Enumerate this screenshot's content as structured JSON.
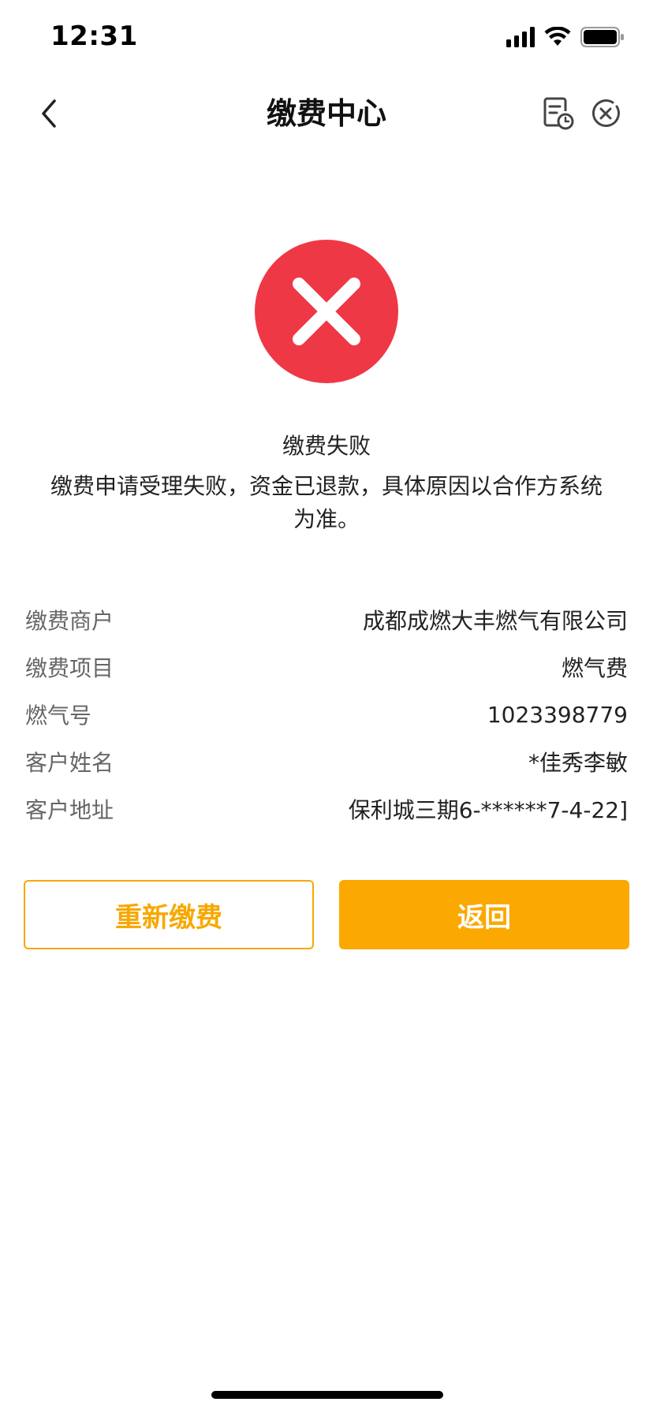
{
  "status_bar": {
    "time": "12:31"
  },
  "nav": {
    "title": "缴费中心",
    "back_icon": "chevron-left-icon",
    "history_icon": "bill-history-icon",
    "close_icon": "close-circle-icon"
  },
  "result": {
    "icon": "error-cross-icon",
    "title": "缴费失败",
    "description": "缴费申请受理失败，资金已退款，具体原因以合作方系统为准。"
  },
  "info": [
    {
      "label": "缴费商户",
      "value": "成都成燃大丰燃气有限公司"
    },
    {
      "label": "缴费项目",
      "value": "燃气费"
    },
    {
      "label": "燃气号",
      "value": "1023398779"
    },
    {
      "label": "客户姓名",
      "value": "*佳秀李敏"
    },
    {
      "label": "客户地址",
      "value": "保利城三期6-******7-4-22]"
    }
  ],
  "buttons": {
    "retry": "重新缴费",
    "back": "返回"
  },
  "colors": {
    "error": "#ee3846",
    "accent": "#fba800",
    "label": "#666666"
  }
}
